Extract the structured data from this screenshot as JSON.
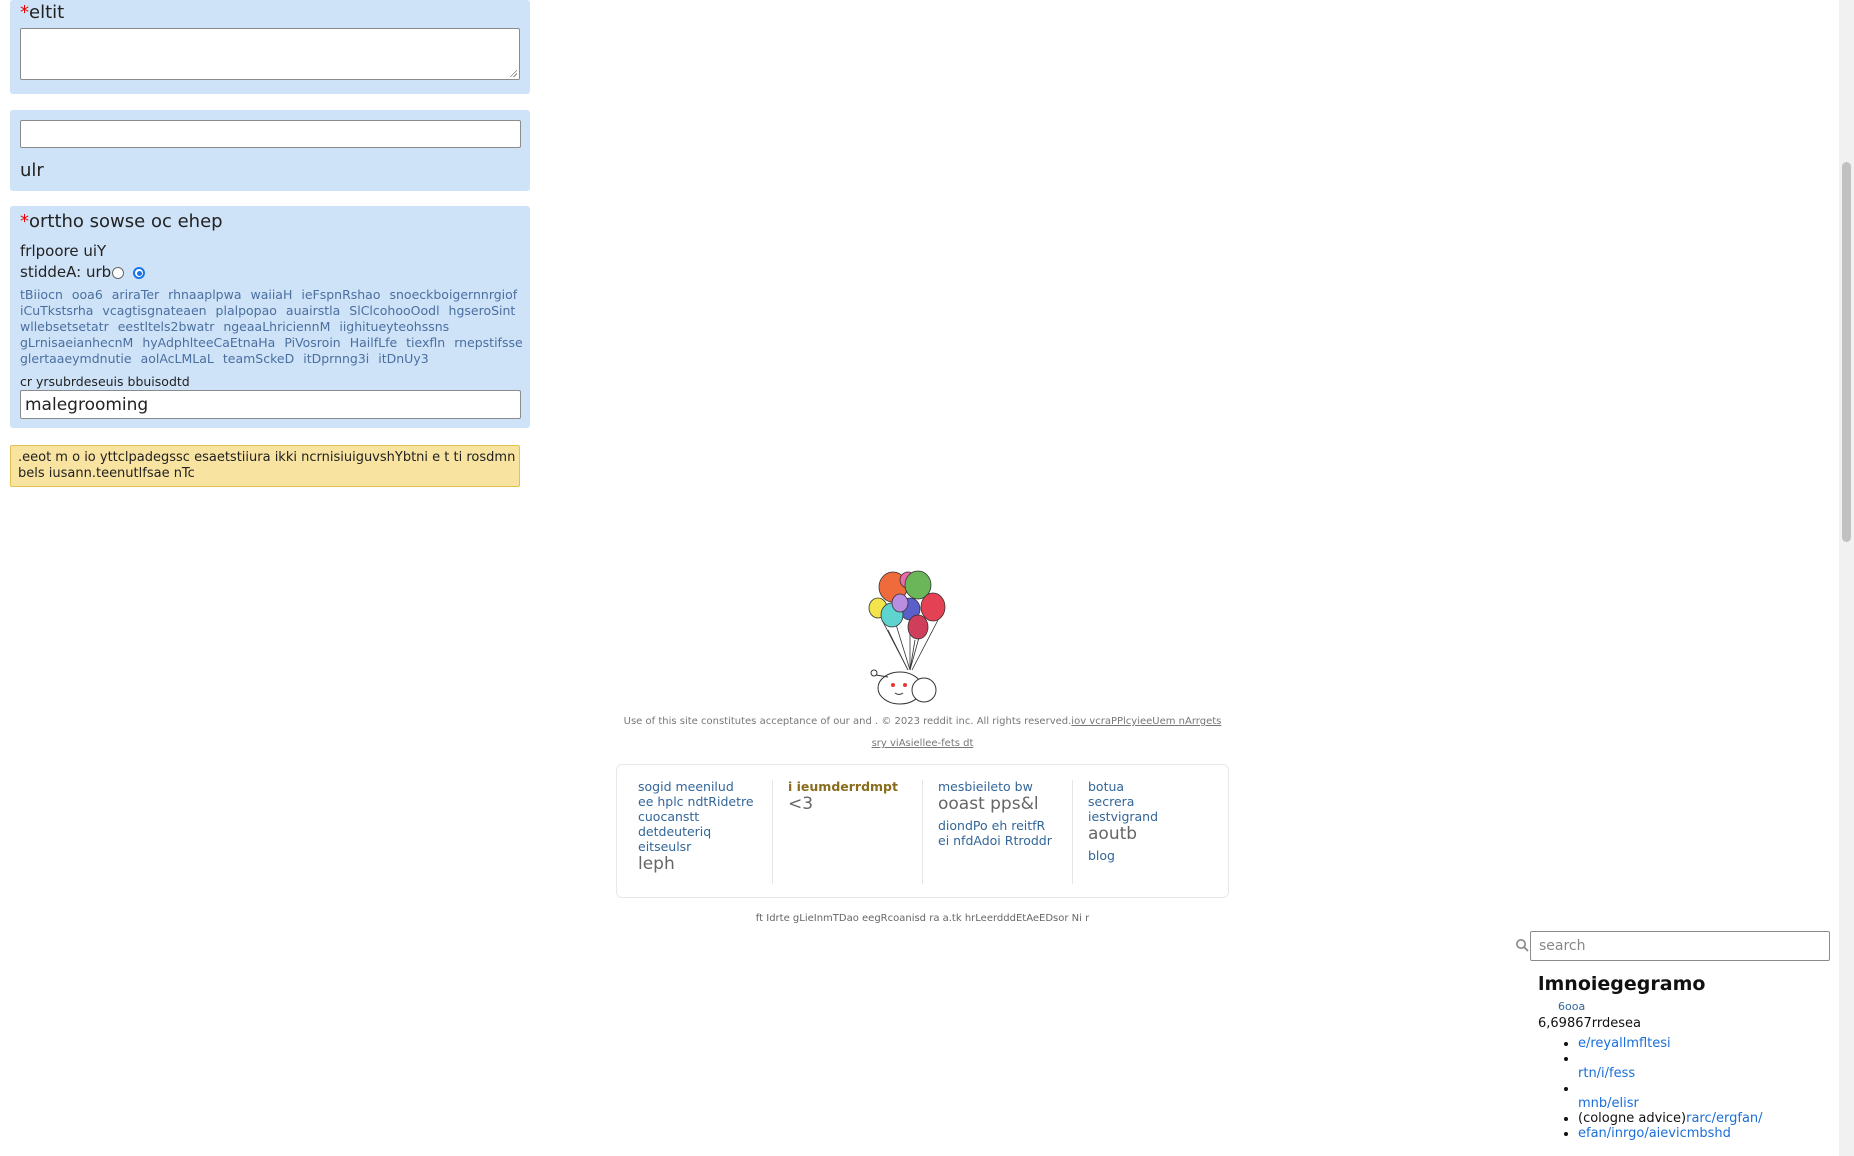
{
  "form": {
    "title_label": "eltit",
    "required_mark": "*",
    "url_label": "ulr",
    "post_to_label": "orttho sowse oc ehep",
    "your_profile": "frlpoore uiY",
    "submit_as_label": "stiddeA: urb",
    "rules_links": [
      "tBiiocn",
      "ooa6",
      "ariraTer",
      "rhnaaplpwa",
      "waiiaH",
      "ieFspnRshao",
      "snoeckboigernnrgiof",
      "iCuTkstsrha",
      "vcagtisgnateaen",
      "plalpopao",
      "auairstla",
      "SlClcohooOodl",
      "hgseroSint",
      "wllebsetsetatr",
      "eestltels2bwatr",
      "ngeaaLhriciennM",
      "iighitueyteohssns",
      "gLrnisaeianhecnM",
      "hyAdphlteeCaEtnaHa",
      "PiVosroin",
      "HailfLfe",
      "tiexfln",
      "rnepstifsse",
      "glertaaeymdnutie",
      "aolAcLMLaL",
      "teamSckeD",
      "itDprnng3i",
      "itDnUy3"
    ],
    "subreddit_label": "cr yrsubrdeseuis bbuisodtd",
    "subreddit_value": "malegrooming",
    "notice": ".eeot m o io yttclpadegssc esaetstiiura ikki ncrnisiuiguvshYbtni e t ti rosdmn bels iusann.teenutlfsae nTc"
  },
  "footer": {
    "legal_line1_plain": "Use of this site constitutes acceptance of our and . © 2023 reddit inc. All rights reserved.",
    "legal_line1_link": "iov vcraPPlcyieeUem nArrgets",
    "legal_line2_link": "sry viAsiellee-fets dt",
    "col1": {
      "links": [
        "sogid meenilud",
        "ee hplc ndtRidetre",
        "cuocanstt",
        "detdeuteriq",
        "eitseulsr"
      ],
      "big": "leph"
    },
    "col2": {
      "title": "i ieumderrdmpt",
      "big": "<3"
    },
    "col3": {
      "link1": "mesbieileto bw",
      "big": "ooast pps&l",
      "links": [
        "diondPo eh reitfR",
        "ei nfdAdoi Rtroddr"
      ]
    },
    "col4": {
      "links": [
        "botua",
        "secrera",
        "iestvigrand"
      ],
      "big": "aoutb",
      "link_last": "blog"
    },
    "bottom_line": "ft Idrte gLieInmTDao eegRcoanisd ra a.tk hrLeerdddEtAeEDsor Ni r"
  },
  "sidebar": {
    "search_placeholder": "search",
    "title": "lmnoiegegramo",
    "small_link": "6ooa",
    "count": "6,69867rrdesea",
    "items": [
      {
        "text": "",
        "link": "e/reyallmfltesi"
      },
      {
        "text": "",
        "link": ""
      },
      {
        "text": "",
        "link": "rtn/i/fess"
      },
      {
        "text": "",
        "link": ""
      },
      {
        "text": "",
        "link": "mnb/elisr"
      },
      {
        "text": "(cologne advice)",
        "link": "rarc/ergfan/"
      },
      {
        "text": "",
        "link": "efan/inrgo/aievicmbshd"
      }
    ]
  }
}
